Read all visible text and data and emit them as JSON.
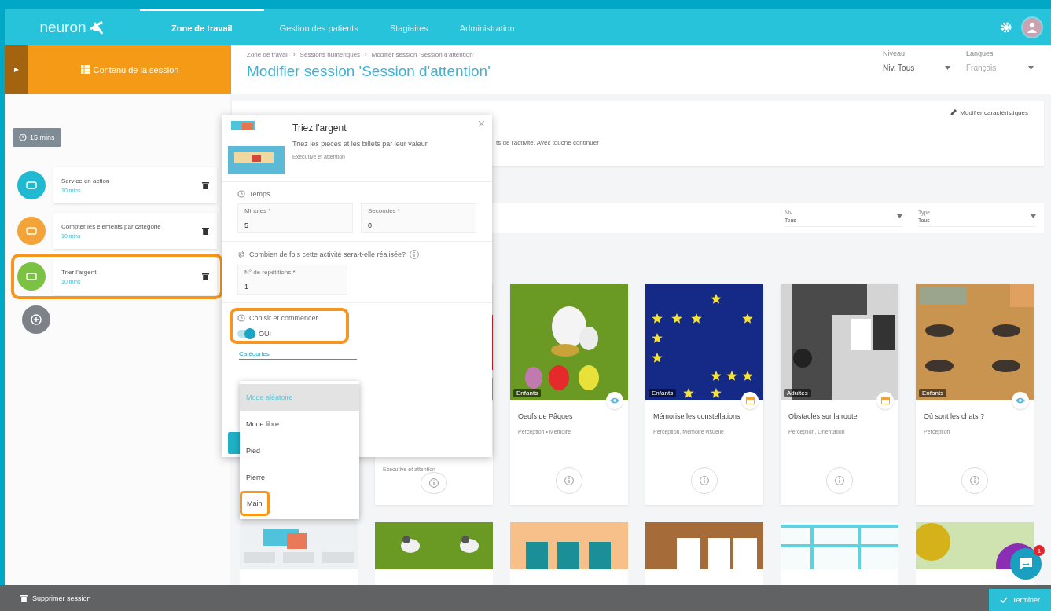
{
  "header": {
    "logo": "neuron",
    "nav": [
      {
        "label": "Zone de travail",
        "selected": true
      },
      {
        "label": "Gestion des patients",
        "selected": false
      },
      {
        "label": "Stagiaires",
        "selected": false
      },
      {
        "label": "Administration",
        "selected": false
      }
    ]
  },
  "subheader": {
    "section_button": "Contenu de la session",
    "breadcrumb": [
      "Zone de travail",
      "Sessions numériques",
      "Modifier session 'Session d'attention'"
    ],
    "breadcrumb_separator": "›",
    "title": "Modifier session 'Session d'attention'",
    "selects": [
      {
        "label": "Niveau",
        "value": "Niv. Tous",
        "disabled": false
      },
      {
        "label": "Langues",
        "value": "Français",
        "disabled": true
      }
    ]
  },
  "sidebar": {
    "duration": "15 mins",
    "items": [
      {
        "name": "Service en action",
        "duration": "10 mins",
        "color": "#1fb9d1",
        "highlighted": false
      },
      {
        "name": "Compter les éléments par catégorie",
        "duration": "10 mins",
        "color": "#f2a33a",
        "highlighted": false
      },
      {
        "name": "Trier l'argent",
        "duration": "10 mins",
        "color": "#7cc242",
        "highlighted": true
      }
    ]
  },
  "description": {
    "edit_link": "Modifier caractéristiques",
    "text": "ts de l'activité. Avec touche continuer"
  },
  "filters": [
    {
      "label": "Niv.",
      "value": "Tous"
    },
    {
      "label": "Type",
      "value": "Tous"
    }
  ],
  "activities": [
    {
      "tags": "Exécutive et attention"
    },
    {
      "title": "Oeufs de Pâques",
      "tags": "Perception • Mémoire",
      "audience": "Enfants",
      "kind": "eye"
    },
    {
      "title": "Mémorise les constellations",
      "tags": "Perception, Mémoire visuelle",
      "audience": "Enfants",
      "kind": "calendar"
    },
    {
      "title": "Obstacles sur la route",
      "tags": "Perception, Orientation",
      "audience": "Adultes",
      "kind": "calendar"
    },
    {
      "title": "Où sont les chats ?",
      "tags": "Perception",
      "audience": "Enfants",
      "kind": "eye"
    }
  ],
  "popup": {
    "title": "Triez l'argent",
    "subtitle": "Triez les pièces et les billets par leur valeur",
    "tags": "Exécutive et attention",
    "time_label": "Temps",
    "fields": [
      {
        "label": "Minutes *",
        "value": "5"
      },
      {
        "label": "Secondes *",
        "value": "0"
      }
    ],
    "repeat_label": "Combien de fois cette activité sera-t-elle réalisée?",
    "repeat_field": {
      "label": "N° de répétitions *",
      "value": "1"
    },
    "start_label": "Choisir et commencer",
    "start_highlighted": true,
    "toggle": {
      "label": "OUI",
      "on": true
    },
    "category_label": "Catégories",
    "options": [
      {
        "label": "Mode aléatoire",
        "selected": true,
        "highlighted": false
      },
      {
        "label": "Mode libre",
        "selected": false,
        "highlighted": false
      },
      {
        "label": "Pied",
        "selected": false,
        "highlighted": false
      },
      {
        "label": "Pierre",
        "selected": false,
        "highlighted": false
      },
      {
        "label": "Main",
        "selected": false,
        "highlighted": true
      }
    ]
  },
  "footer": {
    "delete": "Supprimer session",
    "finish": "Terminer"
  },
  "chat": {
    "badge": "1"
  }
}
